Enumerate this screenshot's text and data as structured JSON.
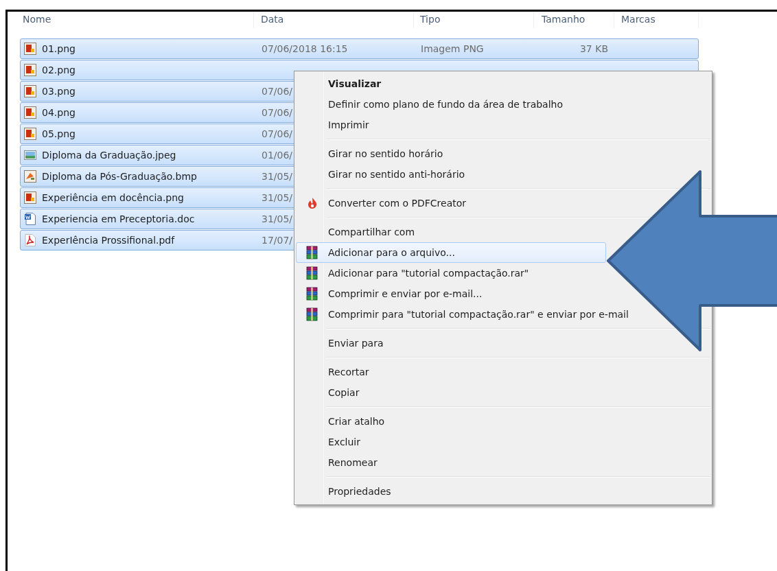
{
  "columns": [
    "Nome",
    "Data",
    "Tipo",
    "Tamanho",
    "Marcas"
  ],
  "files": [
    {
      "name": "01.png",
      "kind": "png",
      "selected": true,
      "date": "07/06/2018 16:15",
      "type": "Imagem PNG",
      "size": "37 KB"
    },
    {
      "name": "02.png",
      "kind": "png",
      "selected": true
    },
    {
      "name": "03.png",
      "kind": "png",
      "selected": true,
      "date": "07/06/"
    },
    {
      "name": "04.png",
      "kind": "png",
      "selected": true,
      "date": "07/06/"
    },
    {
      "name": "05.png",
      "kind": "png",
      "selected": true,
      "date": "07/06/"
    },
    {
      "name": "Diploma da Graduação.jpeg",
      "kind": "jpeg",
      "selected": true,
      "date": "01/06/"
    },
    {
      "name": "Diploma da Pós-Graduação.bmp",
      "kind": "bmp",
      "selected": true,
      "date": "31/05/"
    },
    {
      "name": "Experiência em docência.png",
      "kind": "png",
      "selected": true,
      "date": "31/05/"
    },
    {
      "name": "Experiencia em Preceptoria.doc",
      "kind": "doc",
      "selected": true,
      "date": "31/05/"
    },
    {
      "name": "ExperIência Prossifional.pdf",
      "kind": "pdf",
      "selected": true,
      "date": "17/07/"
    }
  ],
  "menu": {
    "groups": [
      {
        "items": [
          {
            "label": "Visualizar",
            "kind": "plain",
            "default": true,
            "selected": false
          },
          {
            "label": "Definir como plano de fundo da área de trabalho",
            "kind": "plain",
            "default": false,
            "selected": false
          },
          {
            "label": "Imprimir",
            "kind": "plain",
            "default": false,
            "selected": false
          }
        ]
      },
      {
        "items": [
          {
            "label": "Girar no sentido horário",
            "kind": "plain",
            "default": false,
            "selected": false
          },
          {
            "label": "Girar no sentido anti-horário",
            "kind": "plain",
            "default": false,
            "selected": false
          }
        ]
      },
      {
        "items": [
          {
            "label": "Converter com o PDFCreator",
            "kind": "flame",
            "default": false,
            "selected": false
          }
        ]
      },
      {
        "items": [
          {
            "label": "Compartilhar com",
            "kind": "plain",
            "default": false,
            "selected": false
          },
          {
            "label": "Adicionar para o arquivo...",
            "kind": "archive",
            "default": false,
            "selected": true
          },
          {
            "label": "Adicionar para \"tutorial compactação.rar\"",
            "kind": "archive",
            "default": false,
            "selected": false
          },
          {
            "label": "Comprimir e enviar por e-mail...",
            "kind": "archive",
            "default": false,
            "selected": false
          },
          {
            "label": "Comprimir para \"tutorial compactação.rar\" e enviar por e-mail",
            "kind": "archive",
            "default": false,
            "selected": false
          }
        ]
      },
      {
        "items": [
          {
            "label": "Enviar para",
            "kind": "submenu",
            "default": false,
            "selected": false
          }
        ]
      },
      {
        "items": [
          {
            "label": "Recortar",
            "kind": "plain",
            "default": false,
            "selected": false
          },
          {
            "label": "Copiar",
            "kind": "plain",
            "default": false,
            "selected": false
          }
        ]
      },
      {
        "items": [
          {
            "label": "Criar atalho",
            "kind": "plain",
            "default": false,
            "selected": false
          },
          {
            "label": "Excluir",
            "kind": "plain",
            "default": false,
            "selected": false
          },
          {
            "label": "Renomear",
            "kind": "plain",
            "default": false,
            "selected": false
          }
        ]
      },
      {
        "items": [
          {
            "label": "Propriedades",
            "kind": "plain",
            "default": false,
            "selected": false
          }
        ]
      }
    ]
  }
}
